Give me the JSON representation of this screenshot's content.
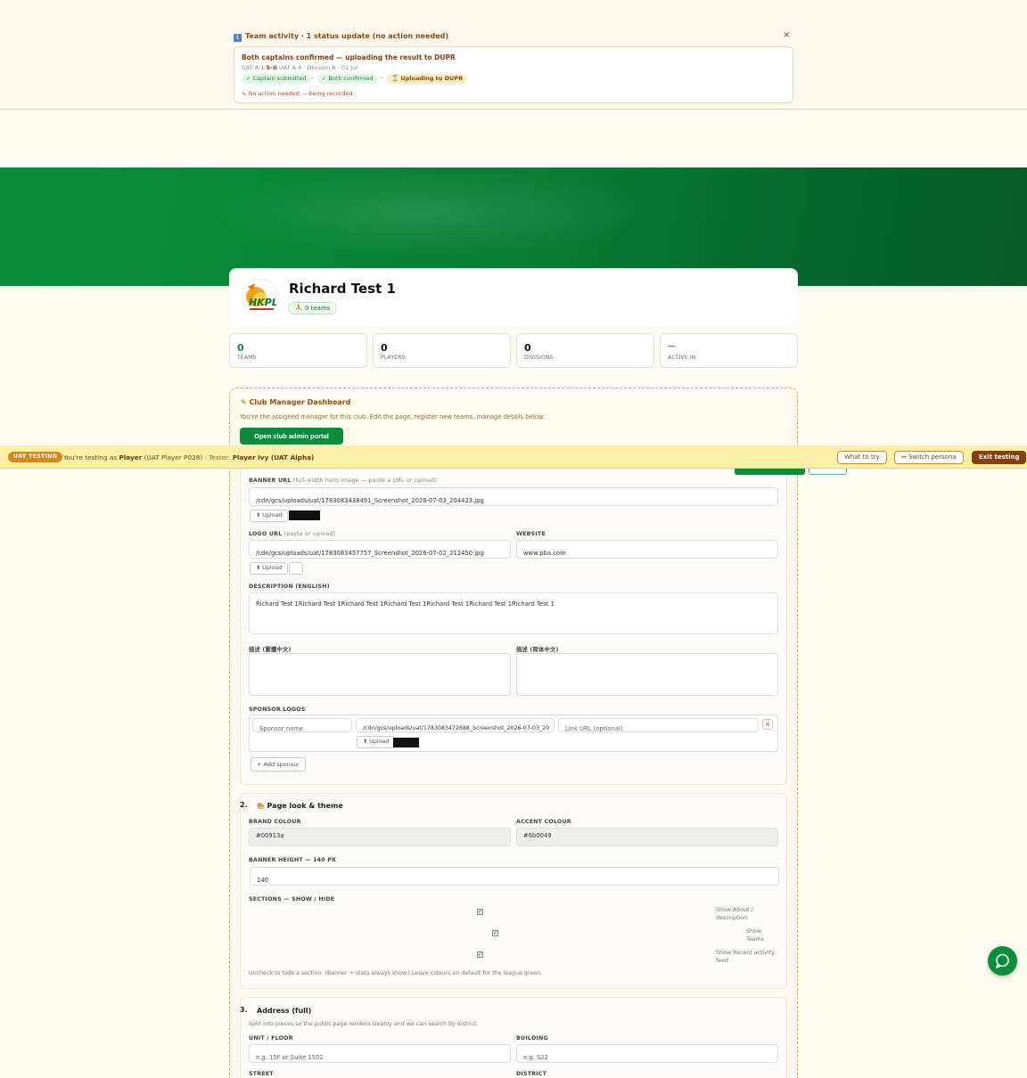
{
  "activity": {
    "title": "Team activity · 1 status update (no action needed)",
    "close": "×",
    "card": {
      "headline": "Both captains confirmed — uploading the result to DUPR",
      "meta_prefix": "UAT A 1 ",
      "score": "5–0",
      "meta_suffix": " UAT A 4 · Division A · 01 Jul",
      "steps": [
        "✓ Captain submitted",
        "✓ Both confirmed",
        "⌛ Uploading to DUPR"
      ],
      "step_arrow": "→",
      "note": "↳ No action needed — being recorded"
    }
  },
  "club": {
    "logo_text": "HKPL",
    "name": "Richard Test 1",
    "teams_pill": "⛹ 0 teams"
  },
  "stats": [
    {
      "value": "0",
      "label": "TEAMS"
    },
    {
      "value": "0",
      "label": "PLAYERS"
    },
    {
      "value": "0",
      "label": "DIVISIONS"
    },
    {
      "value": "—",
      "label": "ACTIVE IN"
    }
  ],
  "manager": {
    "title": "Club Manager Dashboard",
    "subtitle": "You're the assigned manager for this club. Edit the page, register new teams, manage details below.",
    "portal_button": "Open club admin portal"
  },
  "uat": {
    "badge": "UAT TESTING",
    "text_prefix": "You're testing as ",
    "role": "Player",
    "persona": " (UAT Player P028)",
    "tester_prefix": "  · Tester: ",
    "tester": "Player Ivy (UAT Alpha)",
    "what_to_try": "What to try",
    "switch": "↔ Switch persona",
    "exit": "Exit testing"
  },
  "section1": {
    "banner_label": "BANNER URL",
    "banner_hint": " (full-width hero image — paste a URL or upload)",
    "banner_value": "/cdn/gcs/uploads/uat/1783083438491_Screenshot_2026-07-03_204423.jpg",
    "upload": "⬆ Upload",
    "logo_label": "LOGO URL",
    "logo_hint": " (paste or upload)",
    "logo_value": "/cdn/gcs/uploads/uat/1783083457757_Screenshot_2026-07-02_212450.jpg",
    "website_label": "WEBSITE",
    "website_value": "www.pba.com",
    "desc_en_label": "DESCRIPTION (ENGLISH)",
    "desc_en_value": "Richard Test 1Richard Test 1Richard Test 1Richard Test 1Richard Test 1Richard Test 1Richard Test 1",
    "desc_tc_label": "描述 (繁體中文)",
    "desc_sc_label": "描述 (简体中文)",
    "sponsor_label": "SPONSOR LOGOS",
    "sponsor_name_ph": "Sponsor name",
    "sponsor_url_value": "/cdn/gcs/uploads/uat/1783083472688_Screenshot_2026-07-03_20",
    "sponsor_link_ph": "Link URL (optional)",
    "sponsor_remove": "×",
    "add_sponsor": "+ Add sponsor"
  },
  "section2": {
    "num": "2.",
    "icon": "🎨",
    "title": "Page look & theme",
    "brand_label": "BRAND COLOUR",
    "brand_value": "#00913a",
    "accent_label": "ACCENT COLOUR",
    "accent_value": "#6b0049",
    "banner_height_label": "BANNER HEIGHT — 140 PX",
    "banner_height_value": "140",
    "sections_label": "SECTIONS — SHOW / HIDE",
    "toggles": [
      {
        "label": "Show About / description",
        "checked": true
      },
      {
        "label": "Show Teams",
        "checked": true
      },
      {
        "label": "Show Recent activity feed",
        "checked": true
      }
    ],
    "note": "Uncheck to hide a section. (Banner + stats always show.) Leave colours on default for the league green."
  },
  "section3": {
    "num": "3.",
    "title": "Address (full)",
    "subtitle": "Split into pieces so the public page renders cleanly and we can search by district.",
    "unit_label": "UNIT / FLOOR",
    "unit_ph": "e.g. 15F or Suite 1502",
    "building_label": "BUILDING",
    "building_ph": "e.g. S22",
    "street_label": "STREET",
    "district_label": "DISTRICT"
  },
  "colors": {
    "brand": "#0a8e3d",
    "accent_warm": "#8a3d0f",
    "uat_bar": "#fcefa8"
  },
  "icons": {
    "activity": "info-icon",
    "edit": "pencil-icon",
    "chat": "chat-bubble-icon",
    "upload": "upload-icon",
    "palette": "palette-icon"
  }
}
